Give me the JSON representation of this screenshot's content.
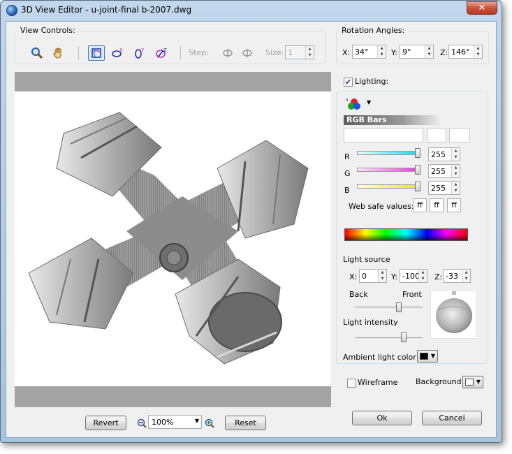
{
  "window": {
    "title": "3D View Editor - u-joint-final b-2007.dwg",
    "close_label": "✕"
  },
  "view_controls": {
    "label": "View Controls:",
    "step_label": "Step:",
    "step_value": "",
    "size_label": "Size:",
    "size_value": "1",
    "icons": [
      "zoom-icon",
      "pan-hand-icon",
      "free-orbit-icon",
      "orbit-x-icon",
      "orbit-y-icon",
      "orbit-z-icon",
      "rotate-left-icon",
      "rotate-right-icon"
    ]
  },
  "rotation": {
    "label": "Rotation Angles:",
    "x_label": "X:",
    "x_value": "34°",
    "y_label": "Y:",
    "y_value": "9°",
    "z_label": "Z:",
    "z_value": "146°"
  },
  "lighting": {
    "checkbox_label": "Lighting:",
    "checked": true,
    "rgb_bars_label": "RGB Bars",
    "r_label": "R",
    "r_value": "255",
    "g_label": "G",
    "g_value": "255",
    "b_label": "B",
    "b_value": "255",
    "web_safe_label": "Web safe values:",
    "web_r": "ff",
    "web_g": "ff",
    "web_b": "ff",
    "light_source_label": "Light source",
    "lx_label": "X:",
    "lx_value": "0",
    "ly_label": "Y:",
    "ly_value": "-100",
    "lz_label": "Z:",
    "lz_value": "-33",
    "back_label": "Back",
    "front_label": "Front",
    "intensity_label": "Light intensity",
    "ambient_label": "Ambient light color",
    "ambient_color": "#000000"
  },
  "wireframe": {
    "label": "Wireframe",
    "checked": false
  },
  "background": {
    "label": "Background",
    "color": "#ffffff"
  },
  "bottom": {
    "revert_label": "Revert",
    "zoom_value": "100%",
    "reset_label": "Reset",
    "ok_label": "Ok",
    "cancel_label": "Cancel"
  },
  "colors": {
    "r_track": "#22d3e6",
    "g_track": "#e639d8",
    "b_track": "#e8e81e",
    "title_bar": "#b4cbe5"
  }
}
